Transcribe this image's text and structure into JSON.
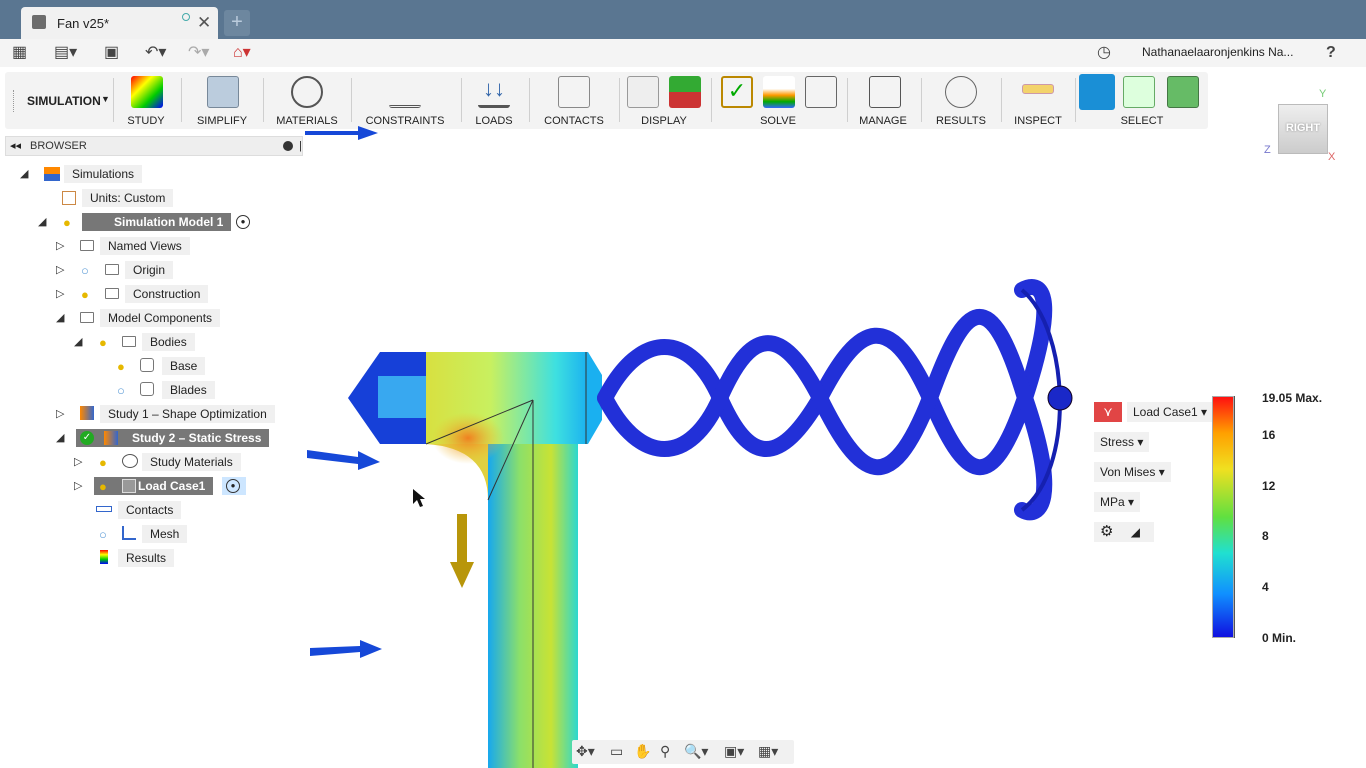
{
  "window": {
    "tab_title": "Fan v25*",
    "new_tab": "+",
    "close": "✕"
  },
  "topbar": {
    "user_name": "Nathanaelaaronjenkins Na...",
    "help": "?"
  },
  "ribbon": {
    "workspace": "SIMULATION",
    "groups": [
      "STUDY",
      "SIMPLIFY",
      "MATERIALS",
      "CONSTRAINTS",
      "LOADS",
      "CONTACTS",
      "DISPLAY",
      "SOLVE",
      "MANAGE",
      "RESULTS",
      "INSPECT",
      "SELECT"
    ]
  },
  "browser": {
    "header": "BROWSER",
    "nodes": [
      "Simulations",
      "Units: Custom",
      "Simulation Model 1",
      "Named Views",
      "Origin",
      "Construction",
      "Model Components",
      "Bodies",
      "Base",
      "Blades",
      "Study 1 – Shape Optimization",
      "Study 2 – Static Stress",
      "Study Materials",
      "Load Case1",
      "Contacts",
      "Mesh",
      "Results"
    ]
  },
  "viewcube": {
    "face": "RIGHT",
    "axis_x": "X",
    "axis_y": "Y",
    "axis_z": "Z"
  },
  "legend": {
    "load_case": "Load Case1",
    "result_type": "Stress",
    "component": "Von Mises",
    "unit": "MPa",
    "max_label": "19.05 Max.",
    "min_label": "0 Min.",
    "ticks": [
      "16",
      "12",
      "8",
      "4"
    ],
    "tick_values": [
      16,
      12,
      8,
      4
    ],
    "max": 19.05,
    "min": 0
  },
  "colors": {
    "tabbar": "#5a7691",
    "ribbon": "#f3f3f3",
    "selection": "#777777",
    "model_blue": "#1f2fd0",
    "load_arrow": "#b8960a"
  }
}
